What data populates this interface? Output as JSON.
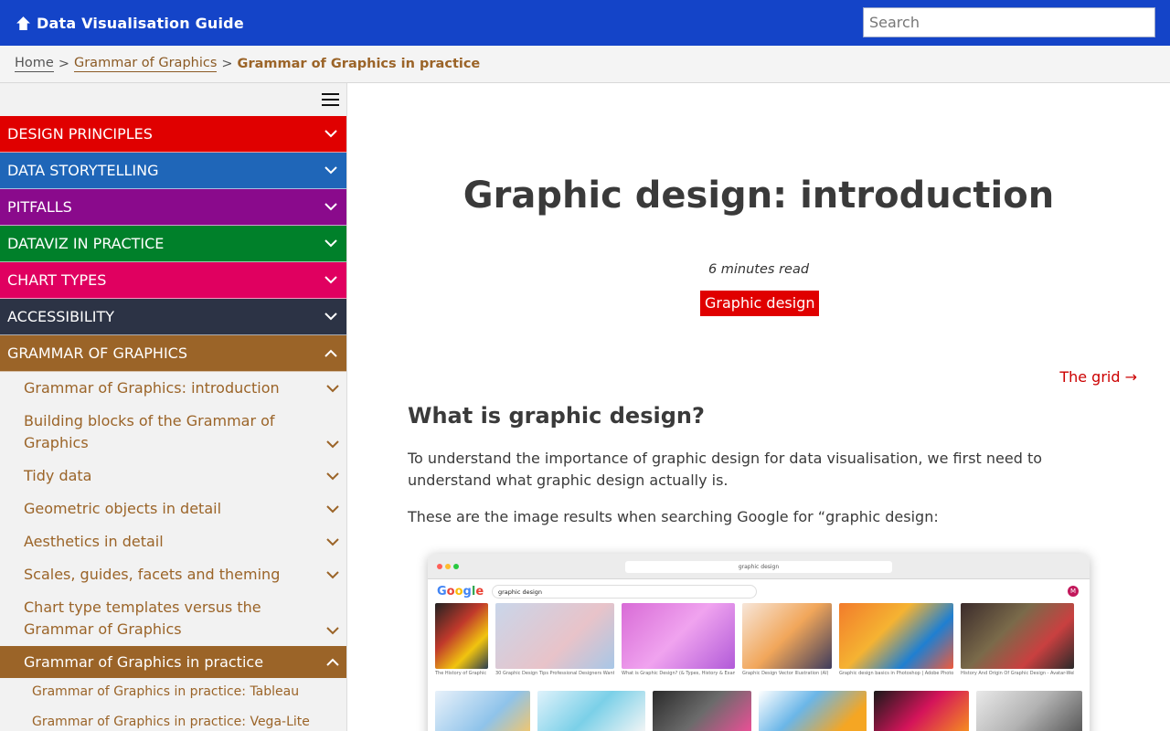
{
  "header": {
    "site_title": "Data Visualisation Guide",
    "search_placeholder": "Search"
  },
  "breadcrumb": {
    "items": [
      "Home",
      "Grammar of Graphics"
    ],
    "separator": ">",
    "current": "Grammar of Graphics in practice"
  },
  "sidebar": {
    "categories": [
      {
        "label": "DESIGN PRINCIPLES",
        "color": "#e00000"
      },
      {
        "label": "DATA STORYTELLING",
        "color": "#1f66b8"
      },
      {
        "label": "PITFALLS",
        "color": "#8a0a8c"
      },
      {
        "label": "DATAVIZ IN PRACTICE",
        "color": "#00802a"
      },
      {
        "label": "CHART TYPES",
        "color": "#e00060"
      },
      {
        "label": "ACCESSIBILITY",
        "color": "#2c3345"
      },
      {
        "label": "GRAMMAR OF GRAPHICS",
        "color": "#9b6428"
      }
    ],
    "sub_items": [
      "Grammar of Graphics: introduction",
      "Building blocks of the Grammar of Graphics",
      "Tidy data",
      "Geometric objects in detail",
      "Aesthetics in detail",
      "Scales, guides, facets and theming",
      "Chart type templates versus the Grammar of Graphics",
      "Grammar of Graphics in practice"
    ],
    "sub_sub_items": [
      "Grammar of Graphics in practice: Tableau",
      "Grammar of Graphics in practice: Vega-Lite"
    ]
  },
  "main": {
    "title": "Graphic design: introduction",
    "read_time": "6 minutes read",
    "tag": "Graphic design",
    "next_link": "The grid →",
    "section_heading": "What is graphic design?",
    "paragraph1": "To understand the importance of graphic design for data visualisation, we first need to understand what graphic design actually is.",
    "paragraph2": "These are the image results when searching Google for “graphic design:"
  },
  "figure": {
    "url": "graphic design",
    "logo": "Google",
    "query": "graphic design",
    "avatar": "M",
    "captions": [
      "The History of Graphic Design",
      "30 Graphic Design Tips Professional Designers Want...",
      "What is Graphic Design? (& Types, History & Exam...",
      "Graphic Design Vector Illustration (AI)",
      "Graphic design basics in Photoshop | Adobe Photo...",
      "History And Origin Of Graphic Design - Avatar-Web..."
    ]
  }
}
